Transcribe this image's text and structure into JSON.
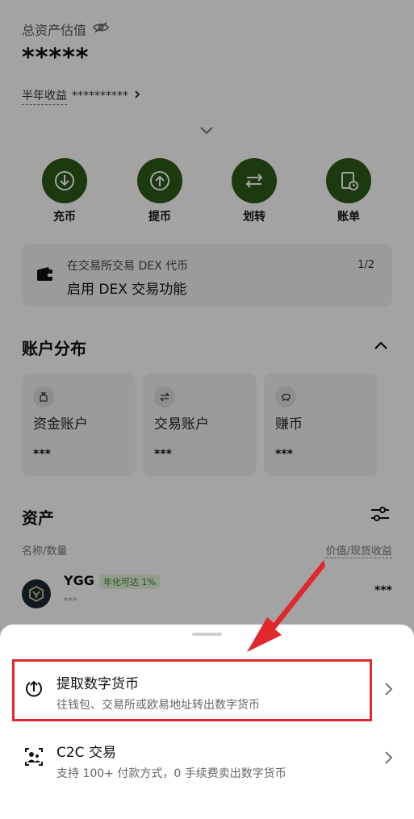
{
  "header": {
    "total_label": "总资产估值",
    "total_value": "*****",
    "earn_label": "半年收益",
    "earn_value": "**********"
  },
  "actions": [
    {
      "label": "充币",
      "icon": "deposit-icon"
    },
    {
      "label": "提币",
      "icon": "withdraw-icon"
    },
    {
      "label": "划转",
      "icon": "transfer-icon"
    },
    {
      "label": "账单",
      "icon": "bill-icon"
    }
  ],
  "dex_banner": {
    "line1": "在交易所交易 DEX 代币",
    "line2": "启用 DEX 交易功能",
    "pager": "1/2"
  },
  "accounts": {
    "title": "账户分布",
    "items": [
      {
        "name": "资金账户",
        "value": "***",
        "icon": "bag-icon"
      },
      {
        "name": "交易账户",
        "value": "***",
        "icon": "swap-icon"
      },
      {
        "name": "赚币",
        "value": "***",
        "icon": "piggy-icon"
      }
    ]
  },
  "assets": {
    "title": "资产",
    "col_left": "名称/数量",
    "col_right": "价值/现货收益",
    "rows": [
      {
        "symbol": "YGG",
        "badge": "年化可达 1%",
        "qty": "***",
        "amount": "***"
      }
    ]
  },
  "sheet": {
    "options": [
      {
        "title": "提取数字货币",
        "subtitle": "往钱包、交易所或欧易地址转出数字货币",
        "icon": "withdraw-icon"
      },
      {
        "title": "C2C 交易",
        "subtitle": "支持 100+ 付款方式，0 手续费卖出数字货币",
        "icon": "c2c-user-icon"
      }
    ]
  },
  "colors": {
    "accent_green": "#2c5a18",
    "highlight_red": "#e0282e"
  }
}
